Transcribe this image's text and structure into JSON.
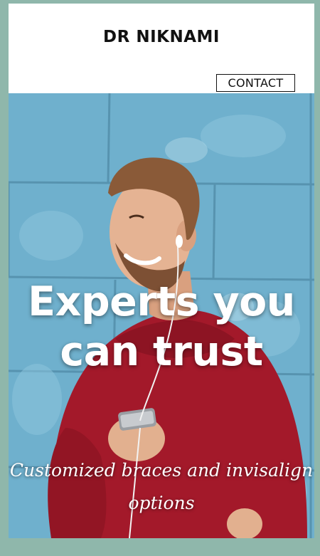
{
  "header": {
    "brand": "DR NIKNAMI",
    "contact_label": "CONTACT"
  },
  "hero": {
    "headline": "Experts you can trust",
    "tagline": "Customized braces and invisalign options",
    "image": "smiling man with earphones and phone in red sweater against blue wall"
  },
  "colors": {
    "page_background": "#8fb7ab",
    "wall_blue": "#6fb0cd",
    "sweater_red": "#a3192a"
  }
}
